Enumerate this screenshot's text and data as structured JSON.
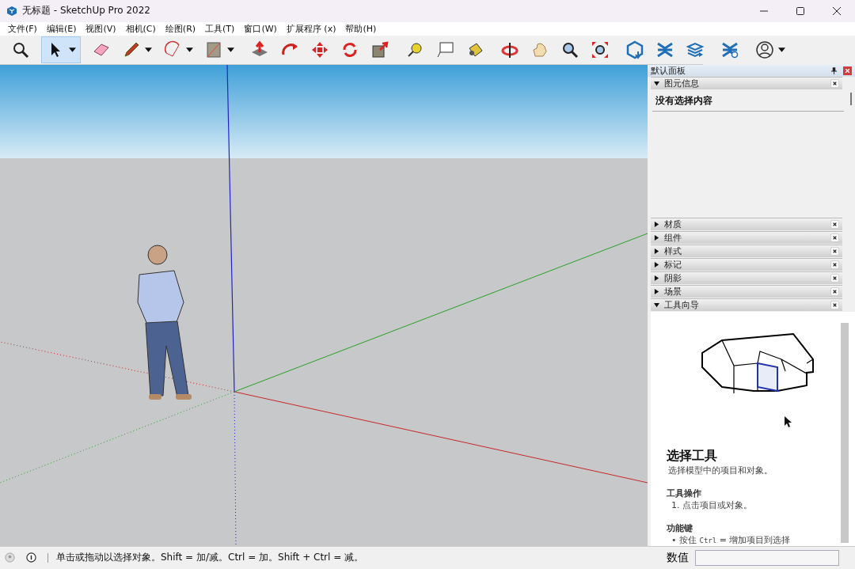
{
  "window": {
    "title": "无标题 - SketchUp Pro 2022"
  },
  "menu": [
    "文件(F)",
    "编辑(E)",
    "视图(V)",
    "相机(C)",
    "绘图(R)",
    "工具(T)",
    "窗口(W)",
    "扩展程序 (x)",
    "帮助(H)"
  ],
  "toolbar": [
    [
      {
        "kind": "zoom-window",
        "selected": false,
        "dropdown": false
      }
    ],
    [
      {
        "kind": "select",
        "selected": true,
        "dropdown": true
      }
    ],
    [
      {
        "kind": "eraser",
        "selected": false,
        "dropdown": false
      },
      {
        "kind": "pencil",
        "selected": false,
        "dropdown": true
      },
      {
        "kind": "arc",
        "selected": false,
        "dropdown": true
      },
      {
        "kind": "rectangle",
        "selected": false,
        "dropdown": true
      }
    ],
    [
      {
        "kind": "pushpull",
        "selected": false,
        "dropdown": false
      },
      {
        "kind": "followme",
        "selected": false,
        "dropdown": false
      },
      {
        "kind": "move",
        "selected": false,
        "dropdown": false
      },
      {
        "kind": "rotate",
        "selected": false,
        "dropdown": false
      },
      {
        "kind": "scale",
        "selected": false,
        "dropdown": false
      }
    ],
    [
      {
        "kind": "tape",
        "selected": false,
        "dropdown": false
      },
      {
        "kind": "text",
        "selected": false,
        "dropdown": false
      },
      {
        "kind": "paint",
        "selected": false,
        "dropdown": false
      }
    ],
    [
      {
        "kind": "orbit",
        "selected": false,
        "dropdown": false
      },
      {
        "kind": "pan",
        "selected": false,
        "dropdown": false
      },
      {
        "kind": "zoom",
        "selected": false,
        "dropdown": false
      },
      {
        "kind": "zoom-extents",
        "selected": false,
        "dropdown": false
      }
    ],
    [
      {
        "kind": "warehouse",
        "selected": false,
        "dropdown": false
      },
      {
        "kind": "extensions",
        "selected": false,
        "dropdown": false
      },
      {
        "kind": "layers",
        "selected": false,
        "dropdown": false
      }
    ],
    [
      {
        "kind": "ext-manager",
        "selected": false,
        "dropdown": false
      }
    ],
    [
      {
        "kind": "account",
        "selected": false,
        "dropdown": true
      }
    ]
  ],
  "panel": {
    "title": "默认面板",
    "sections": [
      {
        "label": "图元信息",
        "expanded": true,
        "kind": "entity_info",
        "content": "没有选择内容"
      },
      {
        "label": "材质",
        "expanded": false
      },
      {
        "label": "组件",
        "expanded": false
      },
      {
        "label": "样式",
        "expanded": false
      },
      {
        "label": "标记",
        "expanded": false
      },
      {
        "label": "阴影",
        "expanded": false
      },
      {
        "label": "场景",
        "expanded": false
      },
      {
        "label": "工具向导",
        "expanded": true,
        "kind": "instructor",
        "tool_title": "选择工具",
        "description": "选择模型中的项目和对象。",
        "operation_heading": "工具操作",
        "steps": [
          "1. 点击项目或对象。"
        ],
        "modifier_heading": "功能键",
        "modifiers": [
          {
            "prefix": "• 按住",
            "key": "Ctrl",
            "text": "= 增加项目到选择"
          }
        ]
      }
    ]
  },
  "status_bar": {
    "message": "单击或拖动以选择对象。Shift = 加/减。Ctrl = 加。Shift + Ctrl = 减。",
    "measurement_label": "数值"
  }
}
